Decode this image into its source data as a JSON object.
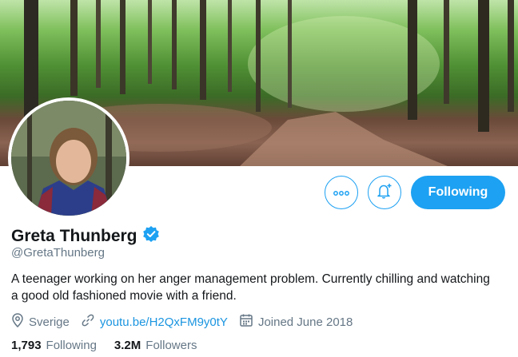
{
  "profile": {
    "display_name": "Greta Thunberg",
    "handle": "@GretaThunberg",
    "bio": "A teenager working on her anger management problem. Currently chilling and watching a good old fashioned movie with a friend.",
    "location": "Sverige",
    "website": "youtu.be/H2QxFM9y0tY",
    "joined": "Joined June 2018",
    "verified": true
  },
  "actions": {
    "follow_label": "Following"
  },
  "stats": {
    "following_count": "1,793",
    "following_label": "Following",
    "followers_count": "3.2M",
    "followers_label": "Followers"
  },
  "icons": {
    "more": "more-dots-icon",
    "notify": "bell-plus-icon",
    "verified": "verified-badge-icon",
    "location": "location-pin-icon",
    "link": "link-icon",
    "calendar": "calendar-icon"
  },
  "colors": {
    "accent": "#1da1f2",
    "link": "#1b95e0",
    "text": "#14171a",
    "secondary": "#657786"
  }
}
